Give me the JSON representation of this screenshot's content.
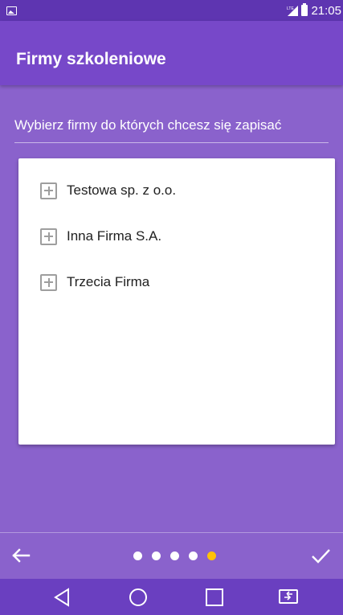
{
  "status_bar": {
    "time": "21:05",
    "network_label": "LTE",
    "icons": [
      "picture-icon",
      "signal-icon",
      "battery-icon"
    ]
  },
  "app_bar": {
    "title": "Firmy szkoleniowe"
  },
  "instruction": "Wybierz firmy do których chcesz się zapisać",
  "companies": [
    {
      "label": "Testowa sp. z o.o.",
      "icon": "plus-box-icon"
    },
    {
      "label": "Inna Firma S.A.",
      "icon": "plus-box-icon"
    },
    {
      "label": "Trzecia Firma",
      "icon": "plus-box-icon"
    }
  ],
  "bottom_bar": {
    "back_icon": "arrow-left-icon",
    "done_icon": "check-icon",
    "pager": {
      "total": 5,
      "active_index": 4
    }
  },
  "nav_bar": {
    "buttons": [
      "back-triangle-icon",
      "home-circle-icon",
      "recents-square-icon",
      "screen-switch-icon"
    ]
  },
  "colors": {
    "status_bar": "#5e35b1",
    "app_bar": "#7748c9",
    "content_bg": "#8a62cc",
    "nav_bar": "#6a3fc0",
    "active_dot": "#ffc107",
    "card_bg": "#ffffff"
  }
}
